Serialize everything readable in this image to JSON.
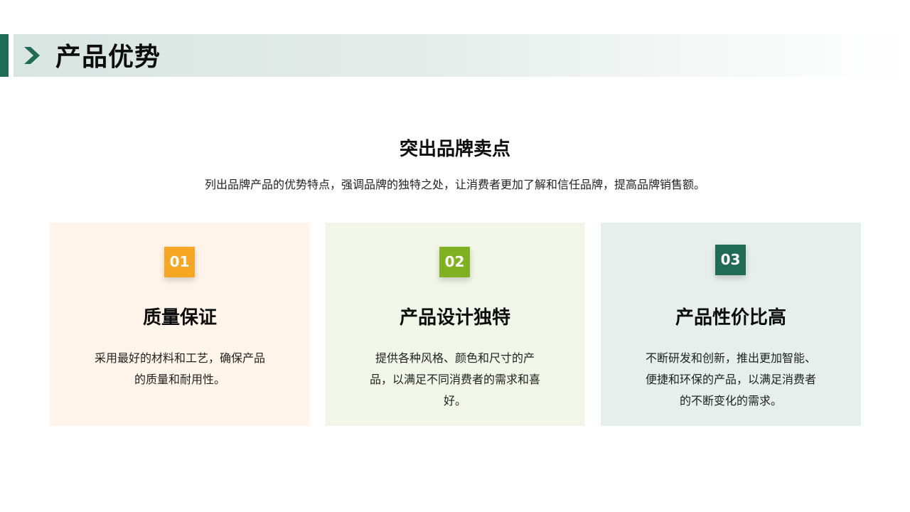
{
  "header": {
    "title": "产品优势",
    "chevron_icon": "chevron-right-icon",
    "accent_color": "#1f6b55"
  },
  "section": {
    "title": "突出品牌卖点",
    "description": "列出品牌产品的优势特点，强调品牌的独特之处，让消费者更加了解和信任品牌，提高品牌销售额。"
  },
  "cards": [
    {
      "number": "01",
      "title": "质量保证",
      "description": "采用最好的材料和工艺，确保产品的质量和耐用性。",
      "badge_color": "#f5a623",
      "background_color": "#fef4e9"
    },
    {
      "number": "02",
      "title": "产品设计独特",
      "description": "提供各种风格、颜色和尺寸的产品，以满足不同消费者的需求和喜好。",
      "badge_color": "#7fb120",
      "background_color": "#f2f6e8"
    },
    {
      "number": "03",
      "title": "产品性价比高",
      "description": "不断研发和创新，推出更加智能、便捷和环保的产品，以满足消费者的不断变化的需求。",
      "badge_color": "#1f6b55",
      "background_color": "#e6efec"
    }
  ]
}
